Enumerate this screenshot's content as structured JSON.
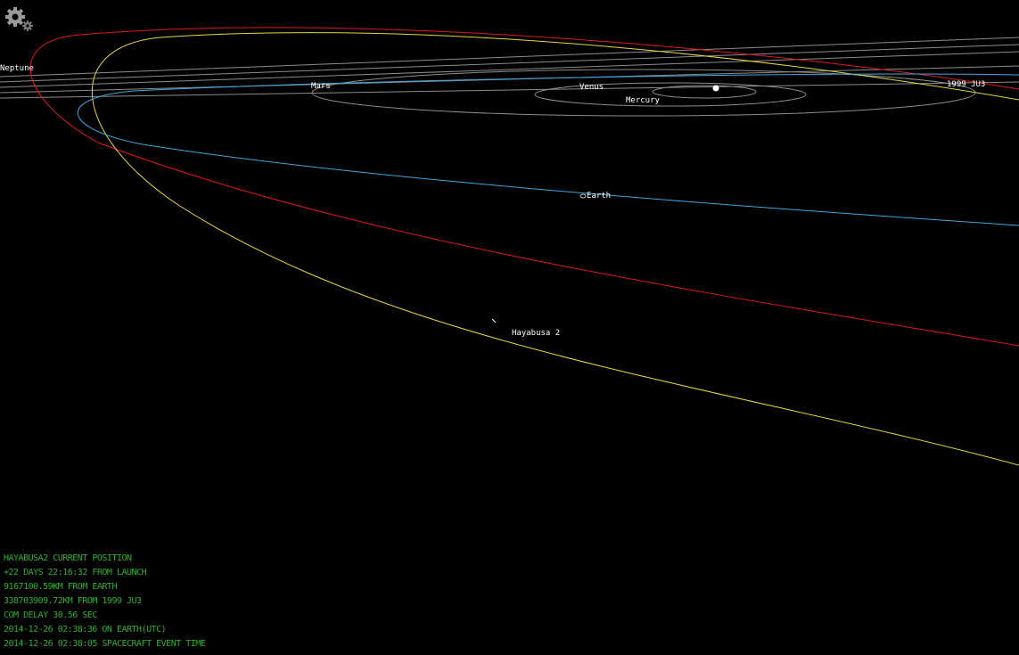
{
  "colors": {
    "background": "#000000",
    "hud_text": "#2fae2f",
    "orbit_gray": "#8c8c8c",
    "earth_orbit": "#3fa7e0",
    "red_orbit": "#e01818",
    "hayabusa_orbit": "#e6d640",
    "sun": "#ffffff",
    "label": "#ffffff"
  },
  "toolbar": {
    "settings_icon": "gear-icon"
  },
  "bodies": {
    "neptune": "Neptune",
    "mars": "Mars",
    "venus": "Venus",
    "mercury": "Mercury",
    "asteroid": "1999 JU3",
    "earth": "Earth",
    "spacecraft": "Hayabusa 2"
  },
  "hud": {
    "line1": "HAYABUSA2 CURRENT POSITION",
    "line2": "+22 DAYS 22:16:32 FROM LAUNCH",
    "line3": "9167100.59KM FROM EARTH",
    "line4": "338703909.72KM FROM 1999 JU3",
    "line5": "COM DELAY 30.56 SEC",
    "line6": "2014-12-26 02:38:36 ON EARTH(UTC)",
    "line7": "2014-12-26 02:38:05 SPACECRAFT EVENT TIME"
  }
}
